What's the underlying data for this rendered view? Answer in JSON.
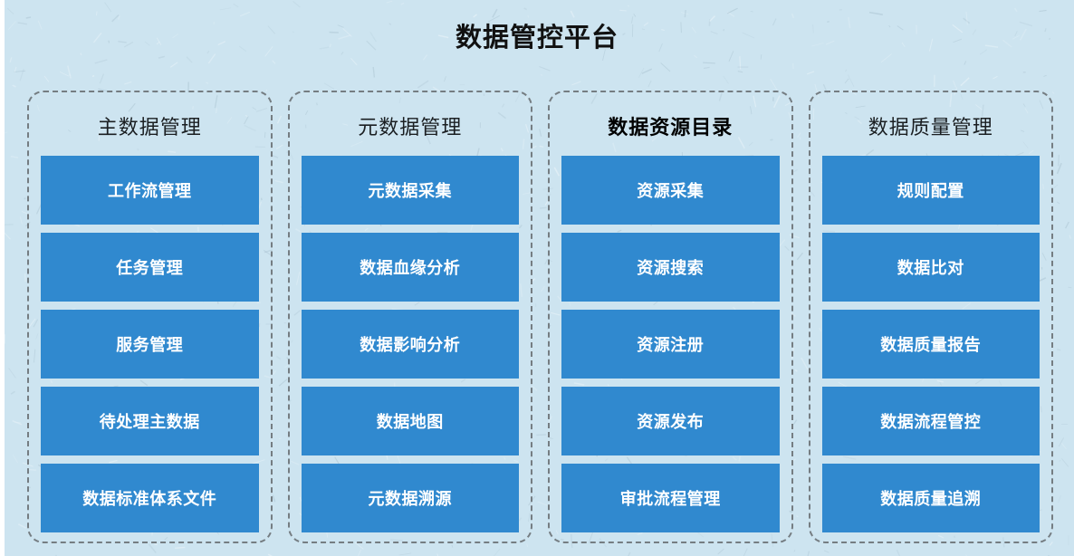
{
  "page": {
    "title": "数据管控平台",
    "background_color": "#cde4f0",
    "tile_color": "#3089cf",
    "tile_text_color": "#ffffff",
    "border_color": "#757d82",
    "title_color": "#111111"
  },
  "columns": [
    {
      "header": "主数据管理",
      "header_bold": false,
      "tiles": [
        "工作流管理",
        "任务管理",
        "服务管理",
        "待处理主数据",
        "数据标准体系文件"
      ]
    },
    {
      "header": "元数据管理",
      "header_bold": false,
      "tiles": [
        "元数据采集",
        "数据血缘分析",
        "数据影响分析",
        "数据地图",
        "元数据溯源"
      ]
    },
    {
      "header": "数据资源目录",
      "header_bold": true,
      "tiles": [
        "资源采集",
        "资源搜索",
        "资源注册",
        "资源发布",
        "审批流程管理"
      ]
    },
    {
      "header": "数据质量管理",
      "header_bold": false,
      "tiles": [
        "规则配置",
        "数据比对",
        "数据质量报告",
        "数据流程管控",
        "数据质量追溯"
      ]
    }
  ]
}
